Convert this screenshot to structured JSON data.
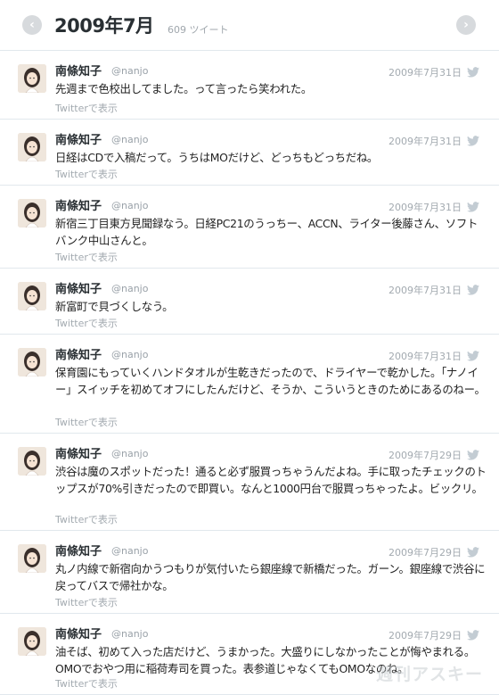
{
  "header": {
    "title": "2009年7月",
    "count": "609 ツイート",
    "prev_icon": "chevron-left-icon",
    "next_icon": "chevron-right-icon"
  },
  "author": {
    "name": "南條知子",
    "handle": "@nanjo"
  },
  "action_label": "Twitterで表示",
  "tweets": [
    {
      "date": "2009年7月31日",
      "text": "先週まで色校出してました。って言ったら笑われた。"
    },
    {
      "date": "2009年7月31日",
      "text": "日経はCDで入稿だって。うちはMOだけど、どっちもどっちだね。"
    },
    {
      "date": "2009年7月31日",
      "text": "新宿三丁目東方見聞録なう。日経PC21のうっちー、ACCN、ライター後藤さん、ソフトバンク中山さんと。"
    },
    {
      "date": "2009年7月31日",
      "text": "新富町で貝づくしなう。"
    },
    {
      "date": "2009年7月31日",
      "text": "保育園にもっていくハンドタオルが生乾きだったので、ドライヤーで乾かした。「ナノイー」スイッチを初めてオフにしたんだけど、そうか、こういうときのためにあるのねー。"
    },
    {
      "date": "2009年7月29日",
      "text": "渋谷は魔のスポットだった！通ると必ず服買っちゃうんだよね。手に取ったチェックのトップスが70%引きだったので即買い。なんと1000円台で服買っちゃったよ。ビックリ。"
    },
    {
      "date": "2009年7月29日",
      "text": "丸ノ内線で新宿向かうつもりが気付いたら銀座線で新橋だった。ガーン。銀座線で渋谷に戻ってバスで帰社かな。"
    },
    {
      "date": "2009年7月29日",
      "text": "油そば、初めて入った店だけど、うまかった。大盛りにしなかったことが悔やまれる。OMOでおやつ用に稲荷寿司を買った。表参道じゃなくてもOMOなのね。"
    }
  ],
  "watermark": "週刊アスキー",
  "colors": {
    "text": "#222222",
    "muted": "#a3aab0",
    "divider": "#e1e8ed",
    "bird": "#c3ccd3"
  }
}
